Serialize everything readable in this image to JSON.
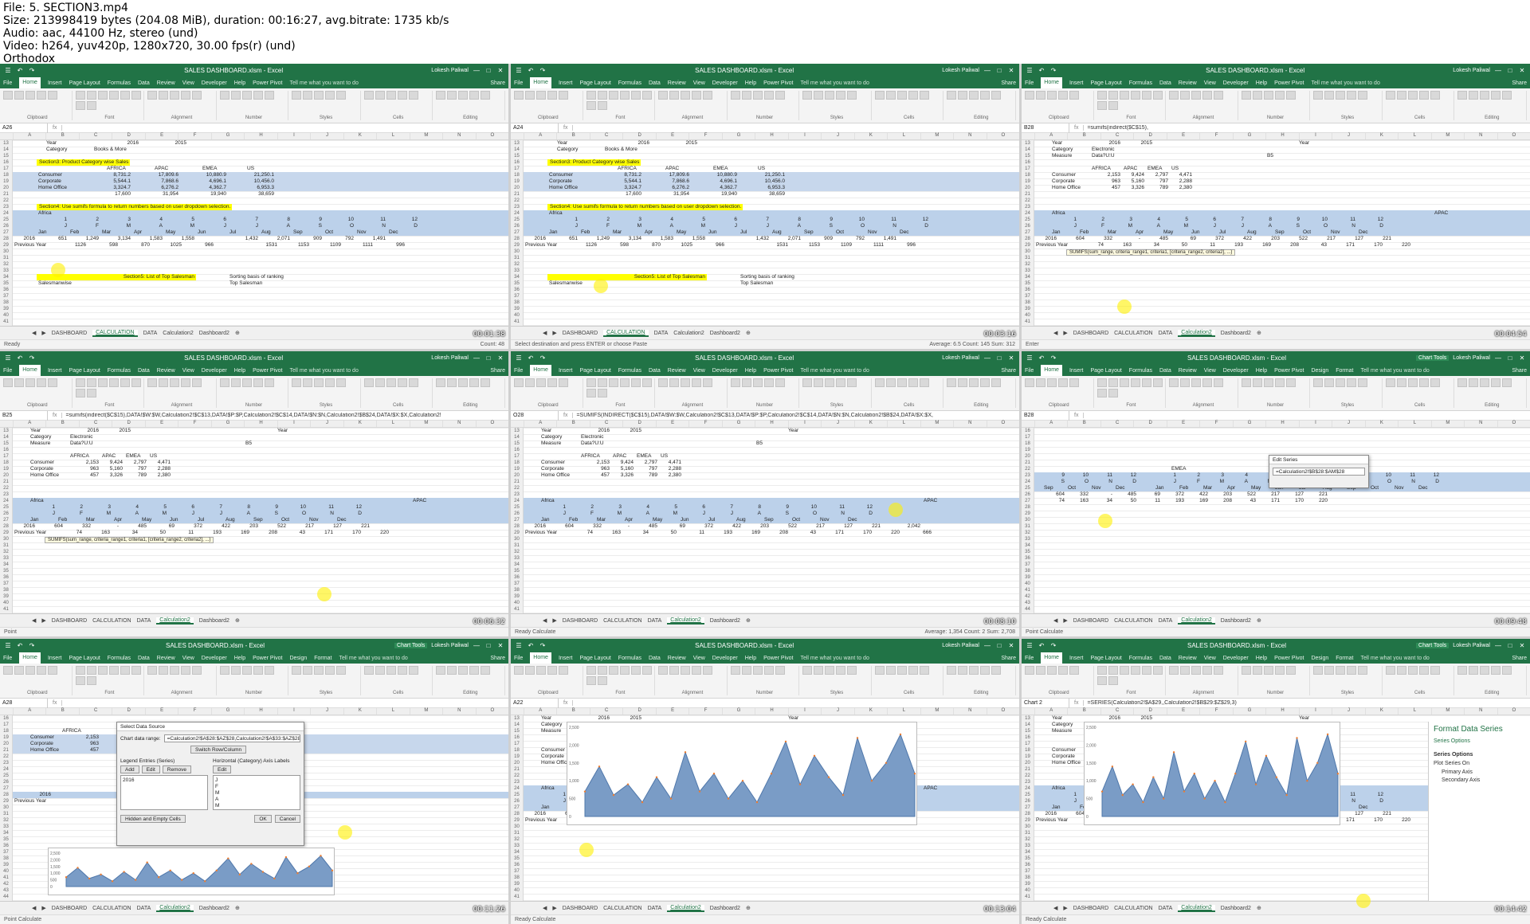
{
  "header": {
    "lines": [
      "File: 5. SECTION3.mp4",
      "Size: 213998419 bytes (204.08 MiB), duration: 00:16:27, avg.bitrate: 1735 kb/s",
      "Audio: aac, 44100 Hz, stereo (und)",
      "Video: h264, yuv420p, 1280x720, 30.00 fps(r) (und)",
      "Orthodox"
    ]
  },
  "app": {
    "title": "SALES DASHBOARD.xlsm - Excel",
    "user": "Lokesh Paliwal",
    "share": "Share",
    "chart_tools": "Chart Tools",
    "tell": "Tell me what you want to do"
  },
  "ribbon_tabs": [
    "File",
    "Home",
    "Insert",
    "Page Layout",
    "Formulas",
    "Data",
    "Review",
    "View",
    "Developer",
    "Help",
    "Power Pivot"
  ],
  "chart_tabs": [
    "Design",
    "Format"
  ],
  "ribbon_groups": [
    "Clipboard",
    "Font",
    "Alignment",
    "Number",
    "Styles",
    "Cells",
    "Editing"
  ],
  "sheet_tabs": [
    "DASHBOARD",
    "CALCULATION",
    "DATA",
    "Calculation2",
    "Dashboard2"
  ],
  "months": [
    "Jan",
    "Feb",
    "Mar",
    "Apr",
    "May",
    "Jun",
    "Jul",
    "Aug",
    "Sep",
    "Oct",
    "Nov",
    "Dec"
  ],
  "tiles": [
    {
      "name": "A26",
      "formula": "",
      "timestamp": "00:01:38",
      "active": "CALCULATION",
      "status": "Ready",
      "statusR": "Count: 48",
      "first": 13
    },
    {
      "name": "A24",
      "formula": "",
      "timestamp": "00:03:16",
      "active": "CALCULATION",
      "status": "Select destination and press ENTER or choose Paste",
      "statusR": "Average: 6.5   Count: 145   Sum: 312",
      "first": 13
    },
    {
      "name": "B28",
      "formula": "=sumifs(indirect($C$15),",
      "timestamp": "00:04:54",
      "active": "Calculation2",
      "status": "Enter",
      "statusR": "",
      "first": 13
    },
    {
      "name": "B25",
      "formula": "=sumifs(indirect($C$15),DATA!$W:$W,Calculation2!$C$13,DATA!$P:$P,Calculation2!$C$14,DATA!$N:$N,Calculation2!$B$24,DATA!$X:$X,Calculation2!",
      "timestamp": "00:06:32",
      "active": "Calculation2",
      "status": "Point",
      "statusR": "",
      "first": 13
    },
    {
      "name": "O28",
      "formula": "=SUMIFS(INDIRECT($C$15),DATA!$W:$W,Calculation2!$C$13,DATA!$P:$P,Calculation2!$C$14,DATA!$N:$N,Calculation2!$B$24,DATA!$X:$X,",
      "timestamp": "00:08:10",
      "active": "Calculation2",
      "status": "Ready   Calculate",
      "statusR": "Average: 1,354   Count: 2   Sum: 2,708",
      "first": 13
    },
    {
      "name": "B28",
      "formula": "",
      "timestamp": "00:09:48",
      "active": "Calculation2",
      "status": "Point   Calculate",
      "statusR": "",
      "first": 16
    },
    {
      "name": "A28",
      "formula": "",
      "timestamp": "00:11:26",
      "active": "Calculation2",
      "status": "Point   Calculate",
      "statusR": "",
      "first": 16
    },
    {
      "name": "A22",
      "formula": "",
      "timestamp": "00:13:04",
      "active": "Calculation2",
      "status": "Ready   Calculate",
      "statusR": "",
      "first": 13
    },
    {
      "name": "Chart 2",
      "formula": "=SERIES(Calculation2!$A$29,,Calculation2!$B$29:$Z$29,3)",
      "timestamp": "00:14:42",
      "active": "Calculation2",
      "status": "Ready   Calculate",
      "statusR": "",
      "first": 13
    }
  ],
  "calc": {
    "year_label": "Year",
    "year_vals": [
      "2016",
      "2015"
    ],
    "category_label": "Category",
    "category_val": "Books & More",
    "section3": "Section3: Product Category wise Sales",
    "regions": [
      "AFRICA",
      "APAC",
      "EMEA",
      "US"
    ],
    "rows": [
      {
        "label": "Consumer",
        "vals": [
          "8,731.2",
          "17,809.6",
          "10,880.9",
          "21,250.1"
        ]
      },
      {
        "label": "Corporate",
        "vals": [
          "5,544.1",
          "7,868.6",
          "4,696.1",
          "10,456.0"
        ]
      },
      {
        "label": "Home Office",
        "vals": [
          "3,324.7",
          "6,276.2",
          "4,362.7",
          "6,953.3"
        ]
      },
      {
        "label": "",
        "vals": [
          "17,600",
          "31,954",
          "19,940",
          "38,659"
        ]
      }
    ],
    "section4": "Section4: Use sumifs formula to return numbers based on user dropdown selection.",
    "africa": "Africa",
    "row2016": [
      "2016",
      "651",
      "1,249",
      "3,134",
      "1,583",
      "1,558",
      "",
      "1,432",
      "2,071",
      "909",
      "792",
      "1,491"
    ],
    "prev_label": "Previous Year",
    "rowPrev": [
      "1126",
      "598",
      "870",
      "1025",
      "966",
      "",
      "1531",
      "1153",
      "1109",
      "1111",
      "996"
    ],
    "section5": "Section5: List of Top Salesman",
    "salesmanwise": "Salesmanwise",
    "sorting": "Sorting basis of ranking",
    "top": "Top Salesman"
  },
  "calc2": {
    "year_label": "Year",
    "year_vals": [
      "2016",
      "2015"
    ],
    "category_label": "Category",
    "category_val": "Electronic",
    "measure_label": "Measure",
    "measure_val": "Data?U:U",
    "b5": "B5",
    "regions": [
      "AFRICA",
      "APAC",
      "EMEA",
      "US"
    ],
    "rows": [
      {
        "label": "Consumer",
        "vals": [
          "2,153",
          "9,424",
          "2,797",
          "4,471"
        ]
      },
      {
        "label": "Corporate",
        "vals": [
          "963",
          "5,160",
          "797",
          "2,288"
        ]
      },
      {
        "label": "Home Office",
        "vals": [
          "457",
          "3,326",
          "789",
          "2,380"
        ]
      }
    ],
    "africa": "Africa",
    "apac": "APAC",
    "nums": [
      "1",
      "2",
      "3",
      "4",
      "5",
      "6",
      "7",
      "8",
      "9",
      "10",
      "11",
      "12"
    ],
    "letters": [
      "J",
      "F",
      "M",
      "A",
      "M",
      "J",
      "J",
      "A",
      "S",
      "O",
      "N",
      "D"
    ],
    "row2016": [
      "2016",
      "604",
      "332",
      "-",
      "485",
      "69",
      "372",
      "422",
      "203",
      "522",
      "217",
      "127",
      "221"
    ],
    "rowPrev": [
      "Previous Year",
      "74",
      "163",
      "34",
      "50",
      "11",
      "193",
      "169",
      "208",
      "43",
      "171",
      "170",
      "220"
    ],
    "o28": "2,042",
    "o29": "666",
    "tip": "SUMIFS(sum_range, criteria_range1, criteria1, [criteria_range2, criteria2], ...)",
    "emea": "EMEA"
  },
  "edit_series": {
    "title": "Edit Series",
    "value": "=Calculation2!$B$28:$AM$28"
  },
  "data_source": {
    "title": "Select Data Source",
    "range_label": "Chart data range:",
    "range": "=Calculation2!$A$28:$AZ$28,Calculation2!$A$33:$AZ$28",
    "switch": "Switch Row/Column",
    "legend": "Legend Entries (Series)",
    "axis": "Horizontal (Category) Axis Labels",
    "add": "Add",
    "edit": "Edit",
    "remove": "Remove",
    "series": "2016",
    "axis_items": [
      "J",
      "F",
      "M",
      "A",
      "M"
    ],
    "hidden": "Hidden and Empty Cells",
    "ok": "OK",
    "cancel": "Cancel"
  },
  "format_pane": {
    "title": "Format Data Series",
    "section": "Series Options",
    "sub": "Series Options",
    "plot_on": "Plot Series On",
    "primary": "Primary Axis",
    "secondary": "Secondary Axis"
  },
  "chart_y": [
    "2,500",
    "2,000",
    "1,500",
    "1,000",
    "500",
    "0"
  ],
  "chart_data": {
    "type": "area",
    "series": [
      {
        "name": "2016",
        "values": [
          700,
          1400,
          600,
          900,
          400,
          1100,
          500,
          1800,
          700,
          1200,
          500,
          1000,
          400,
          1200,
          2100,
          900,
          1700,
          1100,
          600,
          2200,
          1000,
          1500,
          2300,
          1200
        ]
      }
    ]
  }
}
